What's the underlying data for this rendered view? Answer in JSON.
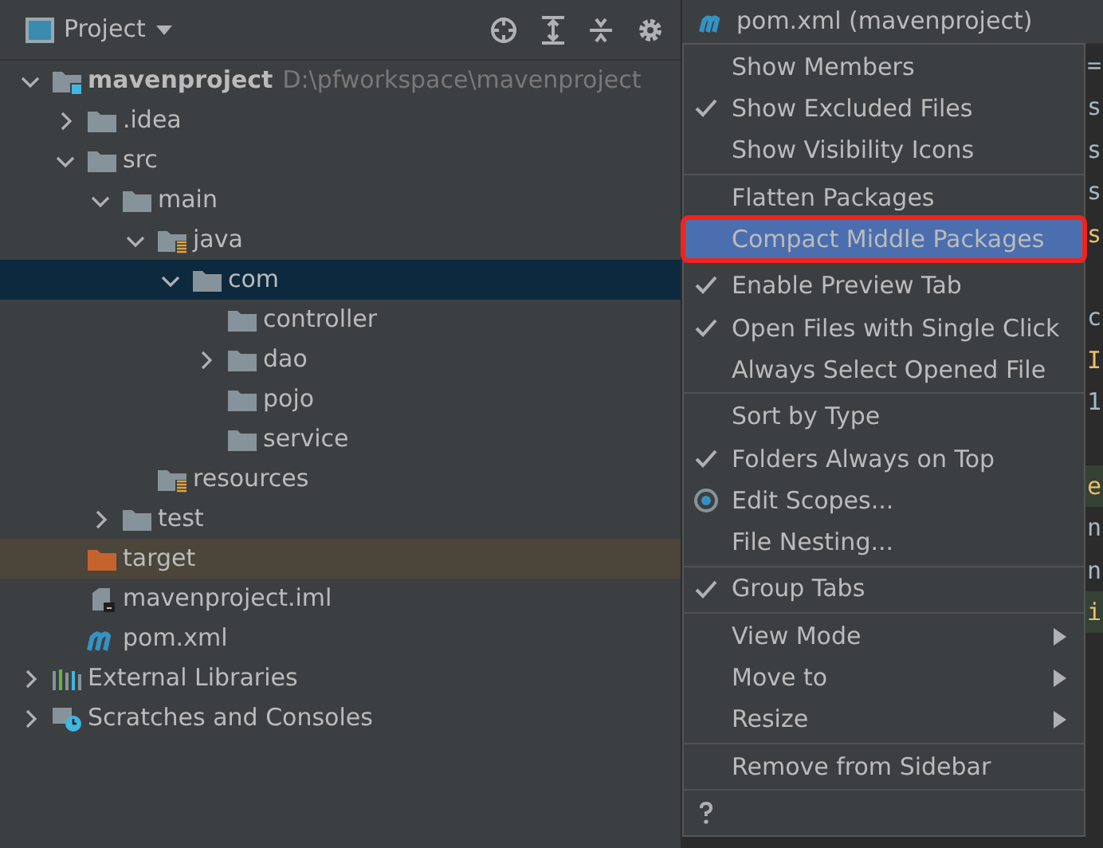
{
  "panel": {
    "title": "Project"
  },
  "tree": [
    {
      "label": "mavenproject",
      "path": "D:\\pfworkspace\\mavenproject",
      "kind": "module",
      "expanded": true,
      "selected": false,
      "excluded": false,
      "children": [
        {
          "label": ".idea",
          "kind": "folder",
          "expanded": false,
          "selected": false,
          "excluded": false
        },
        {
          "label": "src",
          "kind": "folder",
          "expanded": true,
          "selected": false,
          "excluded": false,
          "children": [
            {
              "label": "main",
              "kind": "folder",
              "expanded": true,
              "selected": false,
              "excluded": false,
              "children": [
                {
                  "label": "java",
                  "kind": "root",
                  "expanded": true,
                  "selected": false,
                  "excluded": false,
                  "children": [
                    {
                      "label": "com",
                      "kind": "folder",
                      "expanded": true,
                      "selected": true,
                      "excluded": false,
                      "children": [
                        {
                          "label": "controller",
                          "kind": "folder",
                          "selected": false,
                          "excluded": false
                        },
                        {
                          "label": "dao",
                          "kind": "folder",
                          "expanded": false,
                          "selected": false,
                          "excluded": false
                        },
                        {
                          "label": "pojo",
                          "kind": "folder",
                          "selected": false,
                          "excluded": false
                        },
                        {
                          "label": "service",
                          "kind": "folder",
                          "selected": false,
                          "excluded": false
                        }
                      ]
                    }
                  ]
                },
                {
                  "label": "resources",
                  "kind": "root",
                  "selected": false,
                  "excluded": false
                }
              ]
            },
            {
              "label": "test",
              "kind": "folder",
              "expanded": false,
              "selected": false,
              "excluded": false
            }
          ]
        },
        {
          "label": "target",
          "kind": "folder",
          "selected": false,
          "excluded": true
        },
        {
          "label": "mavenproject.iml",
          "kind": "iml",
          "selected": false,
          "excluded": false
        },
        {
          "label": "pom.xml",
          "kind": "maven",
          "selected": false,
          "excluded": false
        }
      ]
    },
    {
      "label": "External Libraries",
      "kind": "libraries",
      "expanded": false,
      "selected": false,
      "excluded": false
    },
    {
      "label": "Scratches and Consoles",
      "kind": "scratches",
      "expanded": false,
      "selected": false,
      "excluded": false
    }
  ],
  "editor": {
    "tab": "pom.xml (mavenproject)",
    "lines": [
      {
        "text": "=",
        "kind": "code",
        "highlight": false
      },
      {
        "text": "s",
        "kind": "code",
        "highlight": false
      },
      {
        "text": "s",
        "kind": "code",
        "highlight": false
      },
      {
        "text": "s",
        "kind": "code",
        "highlight": false
      },
      {
        "text": "s",
        "kind": "tag",
        "highlight": false
      },
      {
        "kind": "blank"
      },
      {
        "text": "c",
        "kind": "code",
        "highlight": false
      },
      {
        "text": "I",
        "kind": "tag",
        "highlight": false
      },
      {
        "text": "1",
        "kind": "code",
        "highlight": false
      },
      {
        "kind": "blank"
      },
      {
        "text": "e",
        "kind": "tag",
        "highlight": true
      },
      {
        "text": "n",
        "kind": "code",
        "highlight": false
      },
      {
        "text": "n",
        "kind": "code",
        "highlight": false
      },
      {
        "text": "i",
        "kind": "tag",
        "highlight": true
      }
    ]
  },
  "menu": {
    "groups": [
      [
        {
          "label": "Show Members",
          "kind": "toggle",
          "checked": false,
          "selected": false
        },
        {
          "label": "Show Excluded Files",
          "kind": "toggle",
          "checked": true,
          "selected": false
        },
        {
          "label": "Show Visibility Icons",
          "kind": "toggle",
          "checked": false,
          "selected": false
        }
      ],
      [
        {
          "label": "Flatten Packages",
          "kind": "toggle",
          "checked": false,
          "selected": false
        },
        {
          "label": "Compact Middle Packages",
          "kind": "toggle",
          "checked": false,
          "selected": true
        }
      ],
      [
        {
          "label": "Enable Preview Tab",
          "kind": "toggle",
          "checked": true,
          "selected": false
        },
        {
          "label": "Open Files with Single Click",
          "kind": "toggle",
          "checked": true,
          "selected": false
        },
        {
          "label": "Always Select Opened File",
          "kind": "toggle",
          "checked": false,
          "selected": false
        }
      ],
      [
        {
          "label": "Sort by Type",
          "kind": "toggle",
          "checked": false,
          "selected": false
        },
        {
          "label": "Folders Always on Top",
          "kind": "toggle",
          "checked": true,
          "selected": false
        },
        {
          "label": "Edit Scopes...",
          "kind": "scope",
          "checked": false,
          "selected": false
        },
        {
          "label": "File Nesting...",
          "kind": "action",
          "checked": false,
          "selected": false
        }
      ],
      [
        {
          "label": "Group Tabs",
          "kind": "toggle",
          "checked": true,
          "selected": false
        }
      ],
      [
        {
          "label": "View Mode",
          "kind": "submenu",
          "checked": false,
          "selected": false
        },
        {
          "label": "Move to",
          "kind": "submenu",
          "checked": false,
          "selected": false
        },
        {
          "label": "Resize",
          "kind": "submenu",
          "checked": false,
          "selected": false
        }
      ],
      [
        {
          "label": "Remove from Sidebar",
          "kind": "action",
          "checked": false,
          "selected": false
        }
      ],
      [
        {
          "kind": "help",
          "selected": false
        }
      ]
    ]
  }
}
